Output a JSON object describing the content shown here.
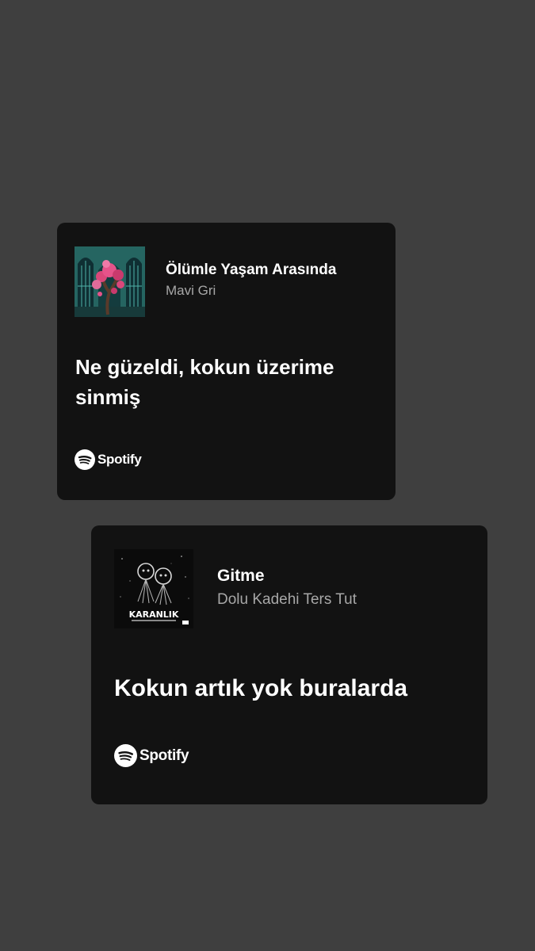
{
  "colors": {
    "background": "#3f3f3f",
    "card": "#121212",
    "title": "#ffffff",
    "artist": "#a7a7a7"
  },
  "cards": [
    {
      "track_title": "Ölümle Yaşam Arasında",
      "artist": "Mavi Gri",
      "lyric": "Ne güzeldi, kokun üzerime sinmiş",
      "brand": "Spotify",
      "brand_icon": "spotify-logo-icon"
    },
    {
      "track_title": "Gitme",
      "artist": "Dolu Kadehi Ters Tut",
      "lyric": "Kokun artık yok buralarda",
      "brand": "Spotify",
      "brand_icon": "spotify-logo-icon",
      "cover_text": "KARANLIK"
    }
  ]
}
